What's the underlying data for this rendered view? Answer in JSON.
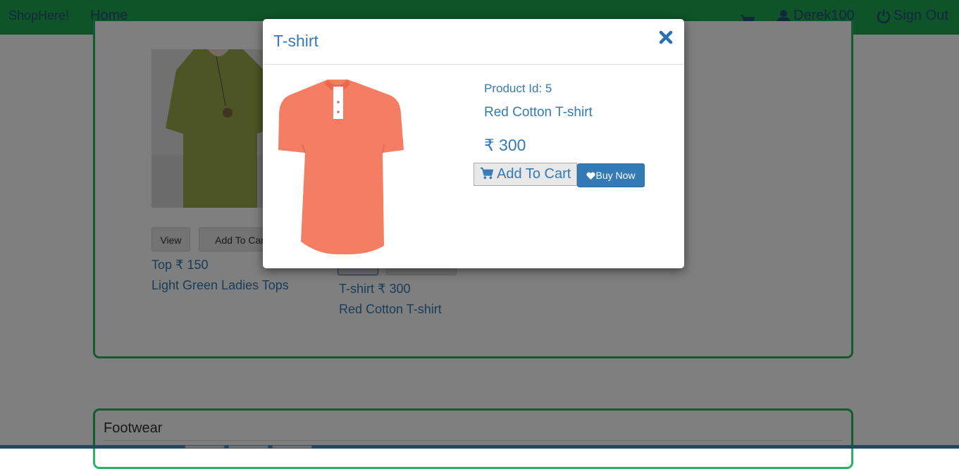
{
  "navbar": {
    "brand": "ShopHere!",
    "home": "Home",
    "user": "Derek100",
    "sign_out": "Sign Out",
    "cart_icon": "cart-icon",
    "user_icon": "user-icon",
    "power_icon": "power-icon"
  },
  "background": {
    "products": [
      {
        "view_label": "View",
        "add_label": "Add To Cart",
        "title_price": "Top ₹ 150",
        "description": "Light Green Ladies Tops"
      },
      {
        "title_price": "T-shirt ₹ 300",
        "description": "Red Cotton T-shirt"
      }
    ],
    "footwear_heading": "Footwear"
  },
  "modal": {
    "title": "T-shirt",
    "product_id": "Product Id: 5",
    "product_name": "Red Cotton T-shirt",
    "price": "₹ 300",
    "add_to_cart": "Add To Cart",
    "buy_now": "Buy Now",
    "close_icon": "close-icon"
  },
  "colors": {
    "navbar": "#1fa653",
    "panel_border": "#28b463",
    "link_blue": "#337ab7",
    "primary_button": "#337ab7",
    "shirt": "#f47e63"
  }
}
